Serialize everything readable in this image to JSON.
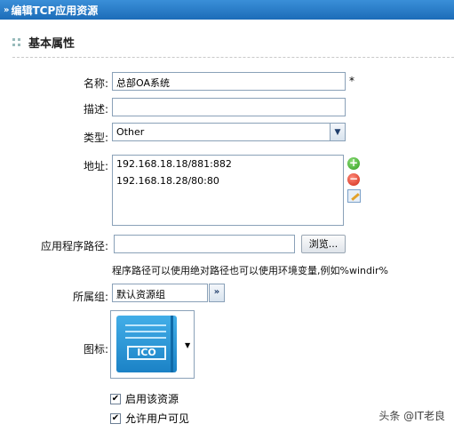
{
  "window": {
    "title": "编辑TCP应用资源"
  },
  "section": {
    "title": "基本属性"
  },
  "form": {
    "name": {
      "label": "名称:",
      "value": "总部OA系统",
      "required": "*"
    },
    "description": {
      "label": "描述:",
      "value": ""
    },
    "type": {
      "label": "类型:",
      "selected": "Other"
    },
    "address": {
      "label": "地址:",
      "items": [
        "192.168.18.18/881:882",
        "192.168.18.28/80:80"
      ]
    },
    "app_path": {
      "label": "应用程序路径:",
      "value": "",
      "browse_label": "浏览...",
      "hint": "程序路径可以使用绝对路径也可以使用环境变量,例如%windir%"
    },
    "group": {
      "label": "所属组:",
      "selected": "默认资源组",
      "button": "»"
    },
    "icon": {
      "label": "图标:",
      "icon_text": "ICO"
    },
    "enable": {
      "label": "启用该资源",
      "checked": true
    },
    "user_visible": {
      "label": "允许用户可见",
      "checked": true
    }
  },
  "watermark": "头条 @IT老良",
  "icons": {
    "add": "plus-circle-icon",
    "remove": "minus-circle-icon",
    "edit": "edit-icon",
    "dropdown": "chevron-down-icon"
  }
}
